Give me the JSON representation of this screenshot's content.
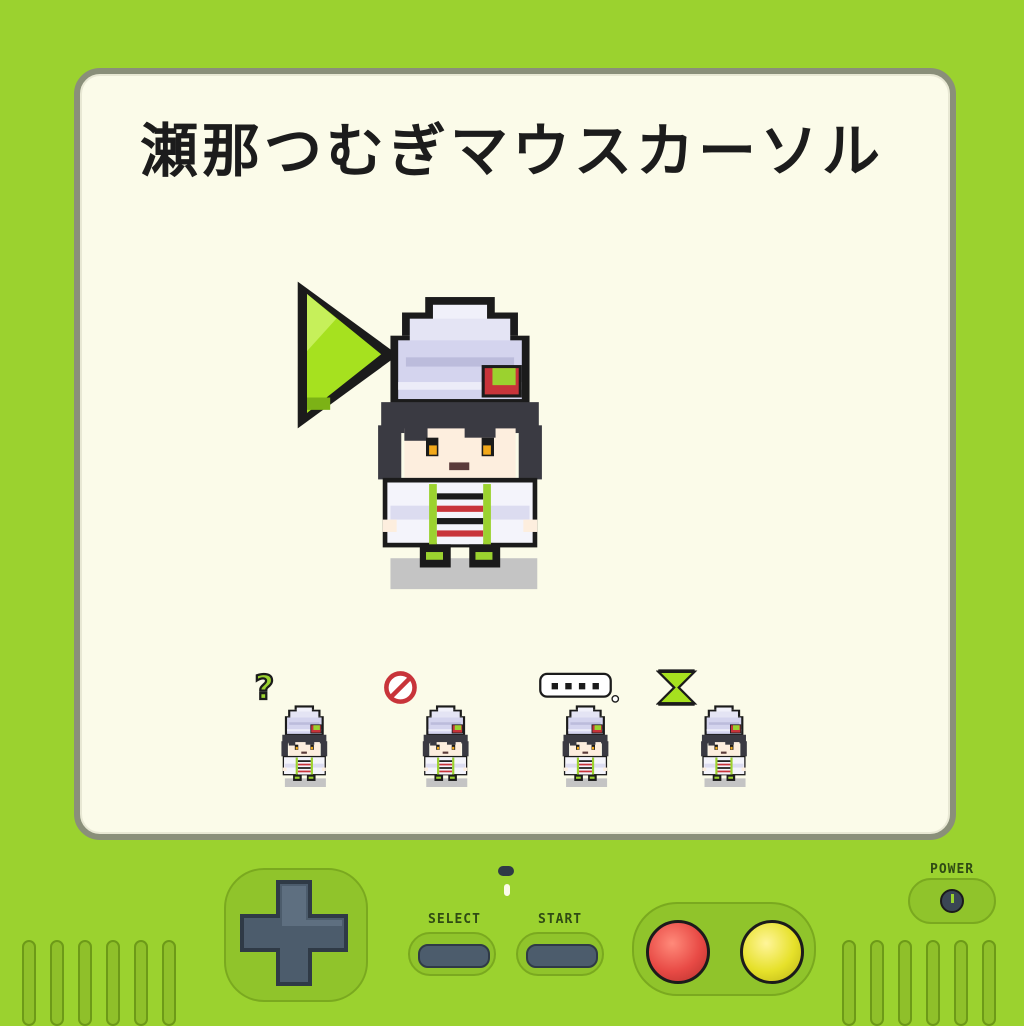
{
  "title": "瀬那つむぎマウスカーソル",
  "console": {
    "select_label": "SELECT",
    "start_label": "START",
    "power_label": "POWER"
  },
  "cursor_states": [
    {
      "name": "normal",
      "icon": "arrow-cursor-icon"
    },
    {
      "name": "help",
      "icon": "question-mark-icon"
    },
    {
      "name": "unavailable",
      "icon": "prohibited-icon"
    },
    {
      "name": "busy",
      "icon": "speech-bubble-dots-icon"
    },
    {
      "name": "wait",
      "icon": "hourglass-icon"
    }
  ],
  "colors": {
    "body": "#9bd22f",
    "screen": "#fbfbe9",
    "accent": "#a6e11f",
    "a_button": "#e84a45",
    "b_button": "#e6e12a"
  }
}
